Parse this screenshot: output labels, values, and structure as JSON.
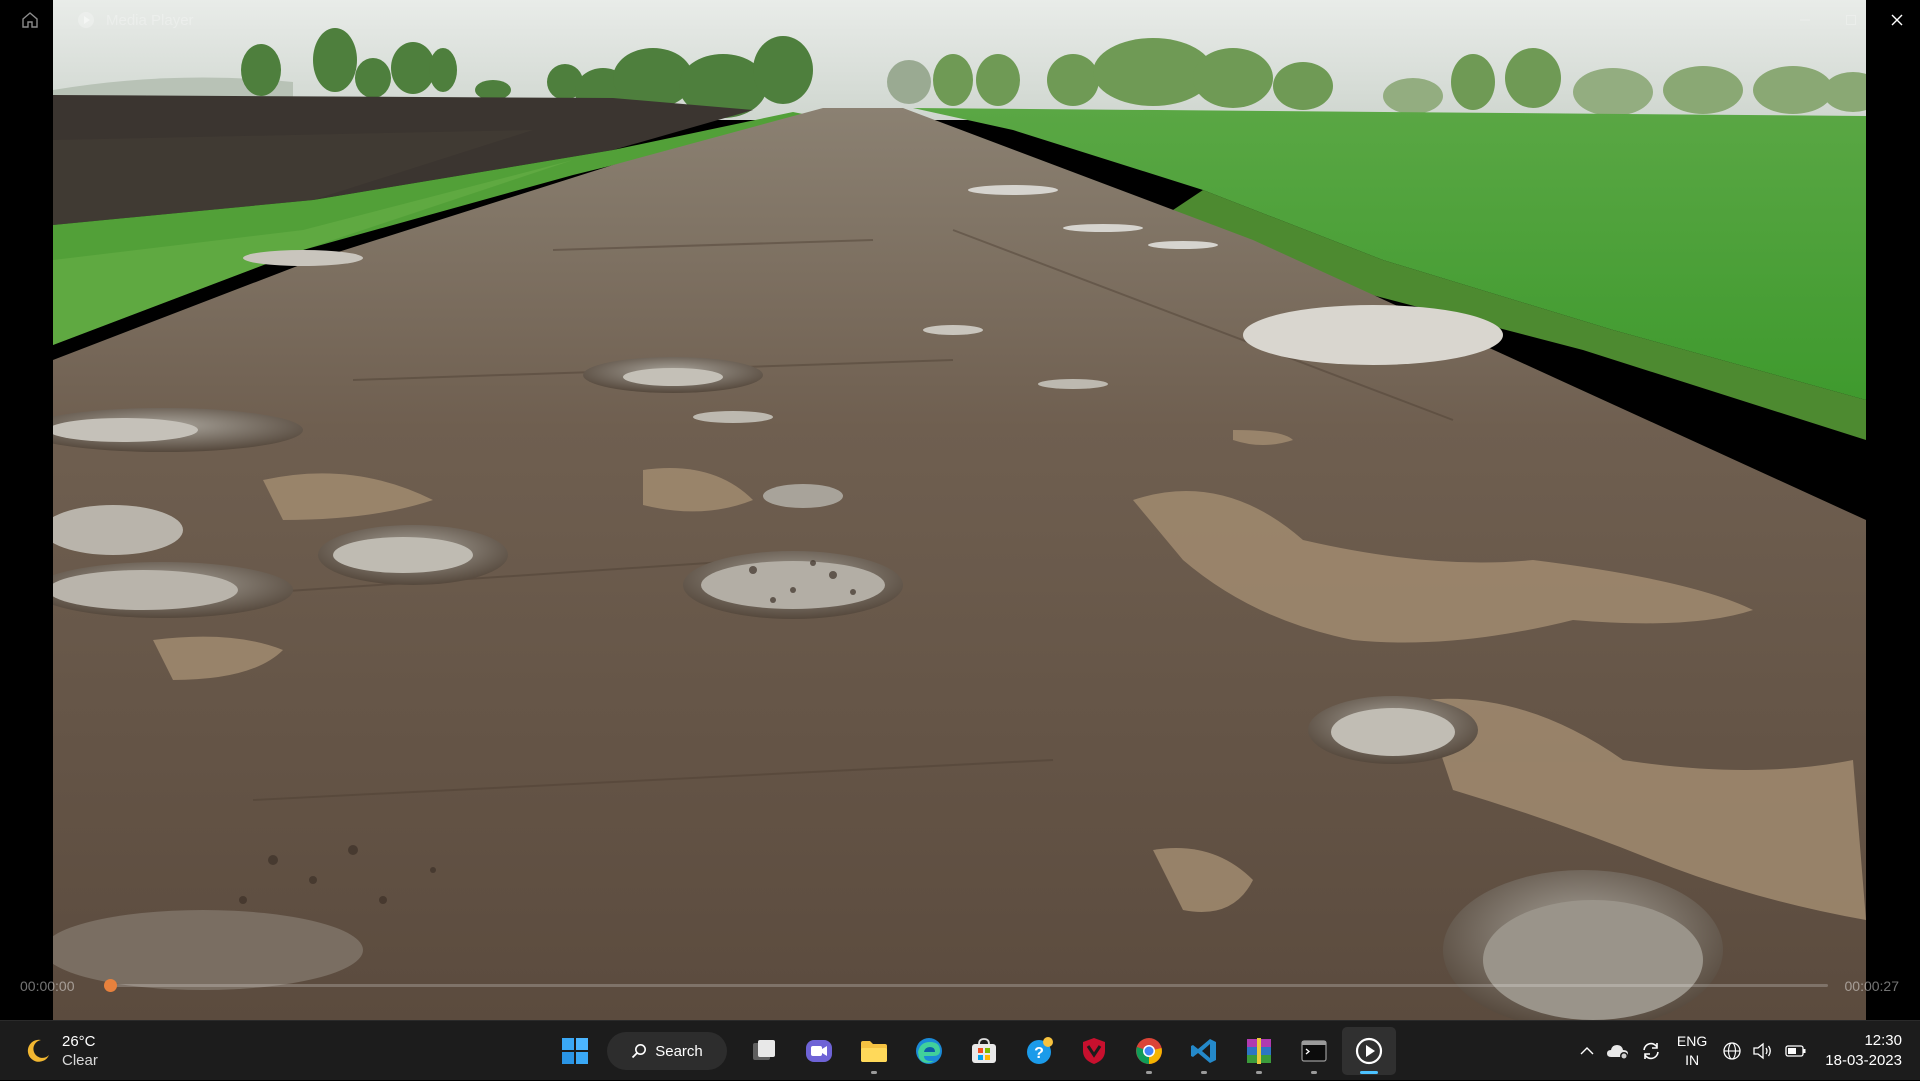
{
  "window": {
    "app_title": "Media Player",
    "home_icon": "home-icon",
    "app_icon": "media-player-icon",
    "controls": [
      "minimize-icon",
      "maximize-icon",
      "close-icon"
    ]
  },
  "video": {
    "scene": "pothole-road-video-frame"
  },
  "playback": {
    "current_time": "00:00:00",
    "total_time": "00:00:27",
    "progress": 0,
    "accent": "#e7813d"
  },
  "taskbar": {
    "weather": {
      "temperature": "26°C",
      "condition": "Clear",
      "icon": "moon-icon"
    },
    "search_label": "Search",
    "apps": [
      {
        "name": "start-button",
        "icon": "windows-logo-icon"
      },
      {
        "name": "search-button",
        "icon": "search-icon"
      },
      {
        "name": "task-view-button",
        "icon": "task-view-icon"
      },
      {
        "name": "teams-button",
        "icon": "video-chat-icon"
      },
      {
        "name": "file-explorer-button",
        "icon": "folder-icon",
        "running": true
      },
      {
        "name": "edge-button",
        "icon": "edge-icon"
      },
      {
        "name": "store-button",
        "icon": "store-icon"
      },
      {
        "name": "get-help-button",
        "icon": "help-icon"
      },
      {
        "name": "mcafee-button",
        "icon": "shield-icon"
      },
      {
        "name": "chrome-button",
        "icon": "chrome-icon",
        "running": true
      },
      {
        "name": "vscode-button",
        "icon": "vscode-icon",
        "running": true
      },
      {
        "name": "winrar-button",
        "icon": "archive-icon",
        "running": true
      },
      {
        "name": "terminal-button",
        "icon": "terminal-icon",
        "running": true
      },
      {
        "name": "media-player-button",
        "icon": "play-icon",
        "active": true
      }
    ],
    "tray": {
      "icons": [
        "chevron-up-icon",
        "onedrive-icon",
        "sync-icon",
        "globe-icon",
        "speaker-icon",
        "battery-icon"
      ],
      "language": "ENG",
      "region": "IN",
      "time": "12:30",
      "date": "18-03-2023"
    }
  }
}
